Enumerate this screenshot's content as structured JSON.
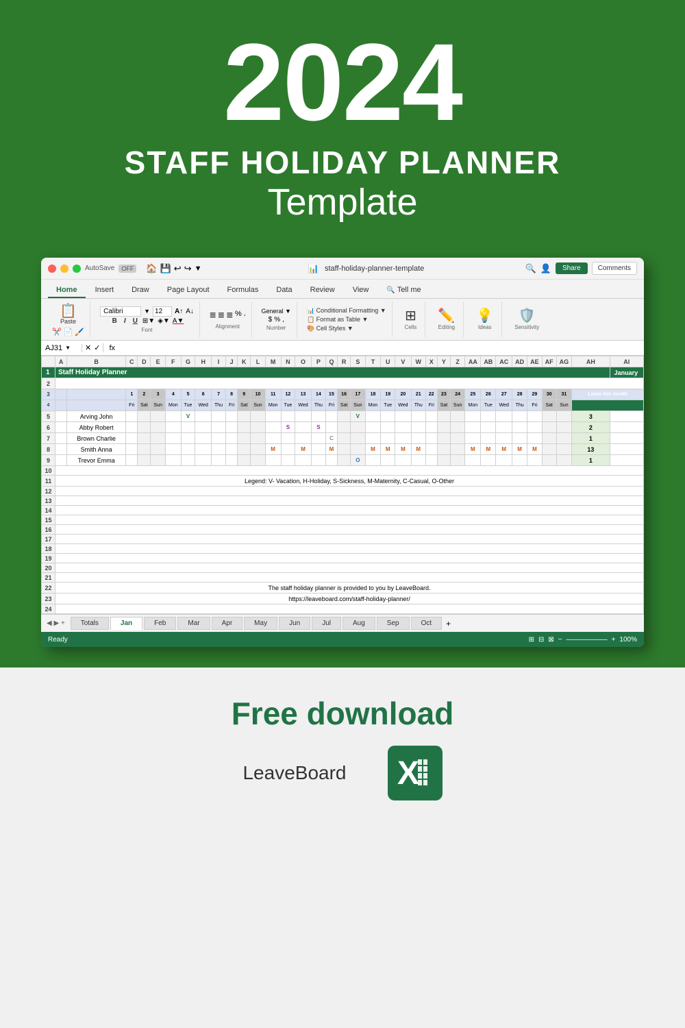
{
  "header": {
    "year": "2024",
    "line1": "STAFF HOLIDAY PLANNER",
    "line2": "Template"
  },
  "excel": {
    "title_bar": {
      "filename": "staff-holiday-planner-template",
      "autosave": "AutoSave",
      "autosave_state": "OFF"
    },
    "tabs": [
      "Home",
      "Insert",
      "Draw",
      "Page Layout",
      "Formulas",
      "Data",
      "Review",
      "View",
      "Tell me"
    ],
    "tell_me_placeholder": "Tell me",
    "ribbon": {
      "paste_label": "Paste",
      "font_name": "Calibri",
      "font_size": "12",
      "alignment_label": "Alignment",
      "number_label": "Number",
      "conditional_formatting": "Conditional Formatting",
      "format_as_table": "Format as Table",
      "cell_styles": "Cell Styles",
      "cells_label": "Cells",
      "editing_label": "Editing",
      "ideas_label": "Ideas",
      "sensitivity_label": "Sensitivity",
      "share_label": "Share",
      "comments_label": "Comments"
    },
    "formula_bar": {
      "cell_ref": "AJ31",
      "formula": "fx"
    },
    "spreadsheet": {
      "title": "Staff Holiday Planner",
      "month": "January",
      "employees": [
        "Arving John",
        "Abby Robert",
        "Brown Charlie",
        "Smith Anna",
        "Trevor Emma"
      ],
      "leave_totals": [
        3,
        2,
        1,
        13,
        1
      ],
      "legend": "Legend: V- Vacation, H-Holiday, S-Sickness, M-Maternity, C-Casual, O-Other",
      "footer_text": "The staff holiday planner is provided to you by LeaveBoard.",
      "footer_link": "https://leaveboard.com/staff-holiday-planner/"
    },
    "sheet_tabs": [
      "Totals",
      "Jan",
      "Feb",
      "Mar",
      "Apr",
      "May",
      "Jun",
      "Jul",
      "Aug",
      "Sep",
      "Oct"
    ],
    "active_tab": "Jan",
    "status_bar": {
      "ready": "Ready",
      "zoom": "100%"
    }
  },
  "bottom": {
    "free_download": "Free download",
    "brand": "LeaveBoard"
  },
  "colors": {
    "green_dark": "#2d7a2d",
    "excel_green": "#217346",
    "light_bg": "#f0f0f0"
  }
}
